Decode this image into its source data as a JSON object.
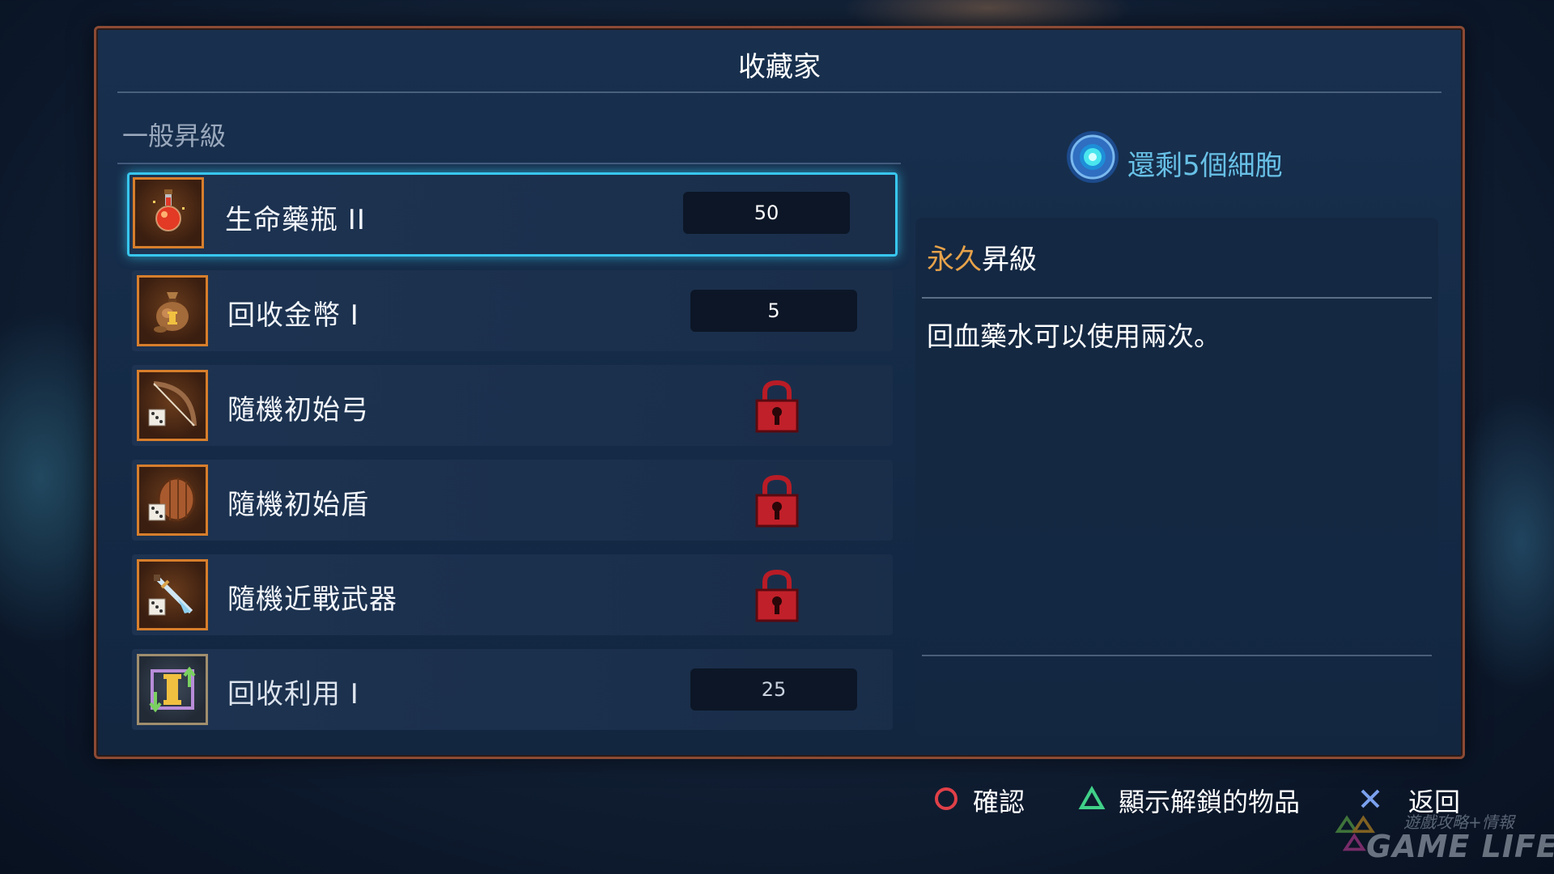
{
  "screen": {
    "title": "收藏家",
    "section_label": "一般昇級"
  },
  "items": [
    {
      "name": "生命藥瓶 II",
      "cost": "50",
      "locked": false,
      "icon": "health-flask-icon",
      "selected": true
    },
    {
      "name": "回收金幣 I",
      "cost": "5",
      "locked": false,
      "icon": "gold-bag-icon",
      "selected": false
    },
    {
      "name": "隨機初始弓",
      "cost": null,
      "locked": true,
      "icon": "random-bow-icon",
      "selected": false
    },
    {
      "name": "隨機初始盾",
      "cost": null,
      "locked": true,
      "icon": "random-shield-icon",
      "selected": false
    },
    {
      "name": "隨機近戰武器",
      "cost": null,
      "locked": true,
      "icon": "random-melee-weapon-icon",
      "selected": false
    },
    {
      "name": "回收利用 I",
      "cost": "25",
      "locked": false,
      "icon": "recycle-icon",
      "selected": false
    }
  ],
  "cells": {
    "text": "還剩5個細胞",
    "icon": "cell-icon"
  },
  "detail": {
    "kind_highlight": "永久",
    "kind_rest": "昇級",
    "description": "回血藥水可以使用兩次。"
  },
  "hints": {
    "confirm": "確認",
    "show_unlocked": "顯示解鎖的物品",
    "back": "返回"
  },
  "watermark": {
    "line1": "遊戲攻略+情報",
    "line2": "GAME LIFE"
  },
  "colors": {
    "selection": "#38c6ee",
    "frame": "#8c4a34",
    "icon_border": "#d77e2c",
    "lock": "#c0202a",
    "cells_text": "#68c0e6",
    "permanent_label": "#e6a24a"
  }
}
